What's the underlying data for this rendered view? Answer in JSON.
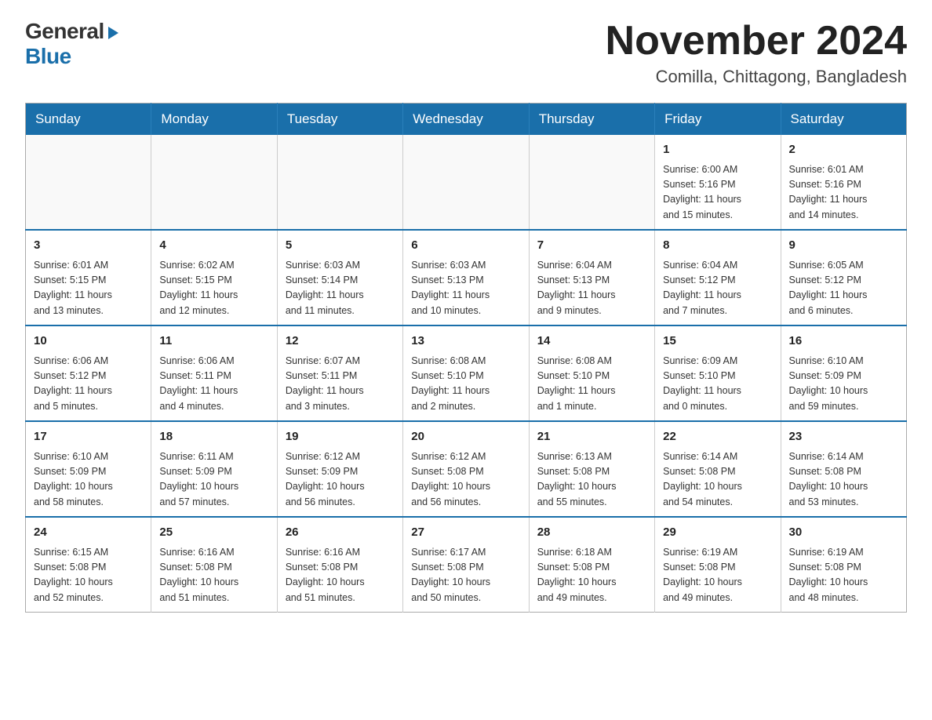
{
  "logo": {
    "general": "General",
    "blue": "Blue"
  },
  "header": {
    "month": "November 2024",
    "location": "Comilla, Chittagong, Bangladesh"
  },
  "weekdays": [
    "Sunday",
    "Monday",
    "Tuesday",
    "Wednesday",
    "Thursday",
    "Friday",
    "Saturday"
  ],
  "weeks": [
    [
      {
        "day": "",
        "info": ""
      },
      {
        "day": "",
        "info": ""
      },
      {
        "day": "",
        "info": ""
      },
      {
        "day": "",
        "info": ""
      },
      {
        "day": "",
        "info": ""
      },
      {
        "day": "1",
        "info": "Sunrise: 6:00 AM\nSunset: 5:16 PM\nDaylight: 11 hours\nand 15 minutes."
      },
      {
        "day": "2",
        "info": "Sunrise: 6:01 AM\nSunset: 5:16 PM\nDaylight: 11 hours\nand 14 minutes."
      }
    ],
    [
      {
        "day": "3",
        "info": "Sunrise: 6:01 AM\nSunset: 5:15 PM\nDaylight: 11 hours\nand 13 minutes."
      },
      {
        "day": "4",
        "info": "Sunrise: 6:02 AM\nSunset: 5:15 PM\nDaylight: 11 hours\nand 12 minutes."
      },
      {
        "day": "5",
        "info": "Sunrise: 6:03 AM\nSunset: 5:14 PM\nDaylight: 11 hours\nand 11 minutes."
      },
      {
        "day": "6",
        "info": "Sunrise: 6:03 AM\nSunset: 5:13 PM\nDaylight: 11 hours\nand 10 minutes."
      },
      {
        "day": "7",
        "info": "Sunrise: 6:04 AM\nSunset: 5:13 PM\nDaylight: 11 hours\nand 9 minutes."
      },
      {
        "day": "8",
        "info": "Sunrise: 6:04 AM\nSunset: 5:12 PM\nDaylight: 11 hours\nand 7 minutes."
      },
      {
        "day": "9",
        "info": "Sunrise: 6:05 AM\nSunset: 5:12 PM\nDaylight: 11 hours\nand 6 minutes."
      }
    ],
    [
      {
        "day": "10",
        "info": "Sunrise: 6:06 AM\nSunset: 5:12 PM\nDaylight: 11 hours\nand 5 minutes."
      },
      {
        "day": "11",
        "info": "Sunrise: 6:06 AM\nSunset: 5:11 PM\nDaylight: 11 hours\nand 4 minutes."
      },
      {
        "day": "12",
        "info": "Sunrise: 6:07 AM\nSunset: 5:11 PM\nDaylight: 11 hours\nand 3 minutes."
      },
      {
        "day": "13",
        "info": "Sunrise: 6:08 AM\nSunset: 5:10 PM\nDaylight: 11 hours\nand 2 minutes."
      },
      {
        "day": "14",
        "info": "Sunrise: 6:08 AM\nSunset: 5:10 PM\nDaylight: 11 hours\nand 1 minute."
      },
      {
        "day": "15",
        "info": "Sunrise: 6:09 AM\nSunset: 5:10 PM\nDaylight: 11 hours\nand 0 minutes."
      },
      {
        "day": "16",
        "info": "Sunrise: 6:10 AM\nSunset: 5:09 PM\nDaylight: 10 hours\nand 59 minutes."
      }
    ],
    [
      {
        "day": "17",
        "info": "Sunrise: 6:10 AM\nSunset: 5:09 PM\nDaylight: 10 hours\nand 58 minutes."
      },
      {
        "day": "18",
        "info": "Sunrise: 6:11 AM\nSunset: 5:09 PM\nDaylight: 10 hours\nand 57 minutes."
      },
      {
        "day": "19",
        "info": "Sunrise: 6:12 AM\nSunset: 5:09 PM\nDaylight: 10 hours\nand 56 minutes."
      },
      {
        "day": "20",
        "info": "Sunrise: 6:12 AM\nSunset: 5:08 PM\nDaylight: 10 hours\nand 56 minutes."
      },
      {
        "day": "21",
        "info": "Sunrise: 6:13 AM\nSunset: 5:08 PM\nDaylight: 10 hours\nand 55 minutes."
      },
      {
        "day": "22",
        "info": "Sunrise: 6:14 AM\nSunset: 5:08 PM\nDaylight: 10 hours\nand 54 minutes."
      },
      {
        "day": "23",
        "info": "Sunrise: 6:14 AM\nSunset: 5:08 PM\nDaylight: 10 hours\nand 53 minutes."
      }
    ],
    [
      {
        "day": "24",
        "info": "Sunrise: 6:15 AM\nSunset: 5:08 PM\nDaylight: 10 hours\nand 52 minutes."
      },
      {
        "day": "25",
        "info": "Sunrise: 6:16 AM\nSunset: 5:08 PM\nDaylight: 10 hours\nand 51 minutes."
      },
      {
        "day": "26",
        "info": "Sunrise: 6:16 AM\nSunset: 5:08 PM\nDaylight: 10 hours\nand 51 minutes."
      },
      {
        "day": "27",
        "info": "Sunrise: 6:17 AM\nSunset: 5:08 PM\nDaylight: 10 hours\nand 50 minutes."
      },
      {
        "day": "28",
        "info": "Sunrise: 6:18 AM\nSunset: 5:08 PM\nDaylight: 10 hours\nand 49 minutes."
      },
      {
        "day": "29",
        "info": "Sunrise: 6:19 AM\nSunset: 5:08 PM\nDaylight: 10 hours\nand 49 minutes."
      },
      {
        "day": "30",
        "info": "Sunrise: 6:19 AM\nSunset: 5:08 PM\nDaylight: 10 hours\nand 48 minutes."
      }
    ]
  ]
}
